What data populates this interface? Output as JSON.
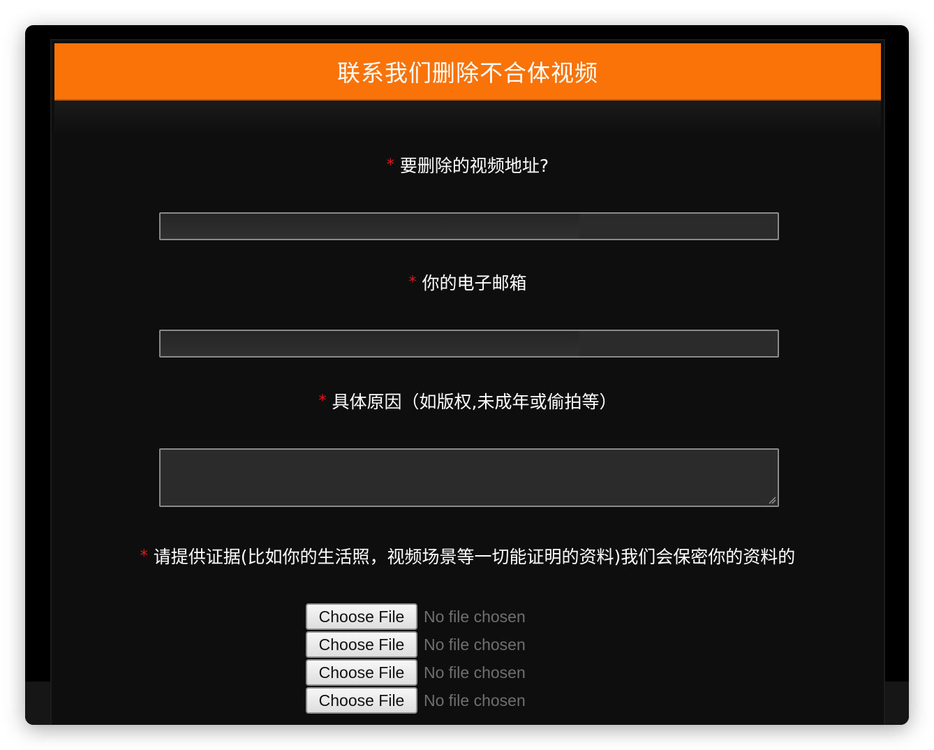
{
  "modal": {
    "title": "联系我们删除不合体视频"
  },
  "form": {
    "required_mark": "*",
    "fields": [
      {
        "label": "要删除的视频地址?",
        "value": ""
      },
      {
        "label": "你的电子邮箱",
        "value": ""
      },
      {
        "label": "具体原因（如版权,未成年或偷拍等）",
        "value": ""
      }
    ],
    "evidence_label": "请提供证据(比如你的生活照，视频场景等一切能证明的资料)我们会保密你的资料的",
    "file_inputs": [
      {
        "button_label": "Choose File",
        "status": "No file chosen"
      },
      {
        "button_label": "Choose File",
        "status": "No file chosen"
      },
      {
        "button_label": "Choose File",
        "status": "No file chosen"
      },
      {
        "button_label": "Choose File",
        "status": "No file chosen"
      }
    ]
  },
  "colors": {
    "header_accent": "#fa7309",
    "required_mark": "#e01b1b",
    "background": "#0e0e0e",
    "input_background": "#2b2b2b"
  }
}
